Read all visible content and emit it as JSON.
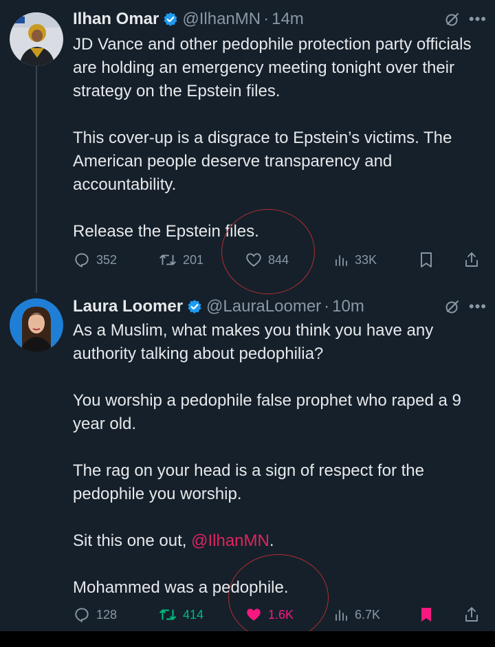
{
  "tweets": [
    {
      "author_name": "Ilhan Omar",
      "handle": "@IlhanMN",
      "separator": "·",
      "time": "14m",
      "verified_icon": "verified-badge-icon",
      "paragraphs": [
        "JD Vance and other pedophile protection party officials are holding an emergency meeting tonight over their strategy on the Epstein files.",
        "This cover-up is a disgrace to Epstein’s victims. The American people deserve transparency and accountability.",
        "Release the Epstein files."
      ],
      "stats": {
        "replies": "352",
        "reposts": "201",
        "likes": "844",
        "views": "33K"
      },
      "liked": false,
      "reposted": false,
      "bookmarked": false
    },
    {
      "author_name": "Laura Loomer",
      "handle": "@LauraLoomer",
      "separator": "·",
      "time": "10m",
      "verified_icon": "verified-badge-icon",
      "paragraphs": [
        "As a Muslim, what makes you think you have any authority talking about pedophilia?",
        "You worship a pedophile false prophet who raped a 9 year old.",
        "The rag on your head is a sign of respect for the pedophile you worship."
      ],
      "closing_prefix": "Sit this one out, ",
      "closing_mention": "@IlhanMN",
      "closing_suffix": ".",
      "final_paragraph": "Mohammed was a pedophile.",
      "stats": {
        "replies": "128",
        "reposts": "414",
        "likes": "1.6K",
        "views": "6.7K"
      },
      "liked": true,
      "reposted": true,
      "bookmarked": true
    }
  ],
  "colors": {
    "background": "#15202b",
    "text": "#e7e9ea",
    "muted": "#8b98a5",
    "verified": "#1d9bf0",
    "like": "#f91880",
    "repost": "#00ba7c",
    "mention": "#e0245e",
    "annotation_circle": "#b0302c"
  }
}
